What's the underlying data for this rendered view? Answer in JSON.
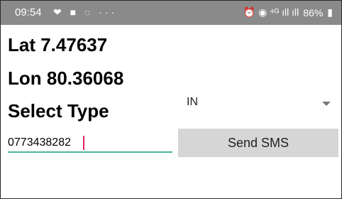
{
  "statusbar": {
    "time": "09:54",
    "left_icons": "❤ ■ ◌ ···",
    "right_icons": "⏰ ◉ ⁴ᴳ ıll ıll",
    "battery": "86%"
  },
  "location": {
    "lat_label": "Lat 7.47637",
    "lon_label": "Lon 80.36068"
  },
  "select_type": {
    "label": "Select Type",
    "selected": "IN"
  },
  "phone": {
    "value": "0773438282"
  },
  "actions": {
    "send_label": "Send SMS"
  }
}
